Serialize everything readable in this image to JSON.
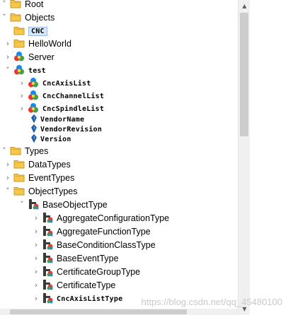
{
  "tree": {
    "root": {
      "label": "Root"
    },
    "objects": {
      "label": "Objects"
    },
    "cnc": {
      "label": "CNC"
    },
    "helloworld": {
      "label": "HelloWorld"
    },
    "server": {
      "label": "Server"
    },
    "test": {
      "label": "test"
    },
    "cncaxislist": {
      "label": "CncAxisList"
    },
    "cncchannellist": {
      "label": "CncChannelList"
    },
    "cncspindlelist": {
      "label": "CncSpindleList"
    },
    "vendorname": {
      "label": "VendorName"
    },
    "vendorrevision": {
      "label": "VendorRevision"
    },
    "version": {
      "label": "Version"
    },
    "types": {
      "label": "Types"
    },
    "datatypes": {
      "label": "DataTypes"
    },
    "eventtypes": {
      "label": "EventTypes"
    },
    "objecttypes": {
      "label": "ObjectTypes"
    },
    "baseobjecttype": {
      "label": "BaseObjectType"
    },
    "aggregateconfigurationtype": {
      "label": "AggregateConfigurationType"
    },
    "aggregatefunctiontype": {
      "label": "AggregateFunctionType"
    },
    "baseconditionclasstype": {
      "label": "BaseConditionClassType"
    },
    "baseeventtype": {
      "label": "BaseEventType"
    },
    "certificategrouptype": {
      "label": "CertificateGroupType"
    },
    "certificatetype": {
      "label": "CertificateType"
    },
    "cncaxislisttype": {
      "label": "CncAxisListType"
    }
  },
  "watermark": "https://blog.csdn.net/qq_45480100",
  "colors": {
    "folder": "#f5c84a",
    "selection": "#d9e8fb",
    "selection_border": "#6a8cc9"
  }
}
